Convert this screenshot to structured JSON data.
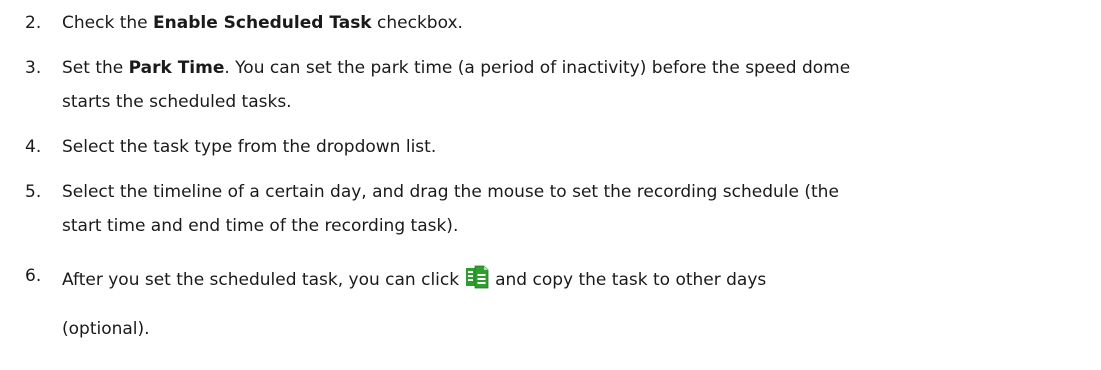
{
  "steps": [
    {
      "number": "2.",
      "text_before": "Check the ",
      "bold": "Enable Scheduled Task",
      "text_after": " checkbox."
    },
    {
      "number": "3.",
      "text_before": "Set the ",
      "bold": "Park Time",
      "text_after": ". You can set the park time (a period of inactivity) before the speed dome",
      "continuation": "starts the scheduled tasks."
    },
    {
      "number": "4.",
      "text": "Select the task type from the dropdown list."
    },
    {
      "number": "5.",
      "line1": "Select the timeline of a certain day, and drag the mouse to set the recording schedule (the",
      "line2": "start time and end time of the recording task)."
    },
    {
      "number": "6.",
      "text_before": "After you set the scheduled task, you can click",
      "icon": "copy-icon",
      "text_after": "and copy the task to other days",
      "continuation": "(optional)."
    }
  ],
  "colors": {
    "text": "#1a1a1a",
    "icon_green": "#2e9e2e",
    "icon_dark_green": "#1f7a1f"
  }
}
